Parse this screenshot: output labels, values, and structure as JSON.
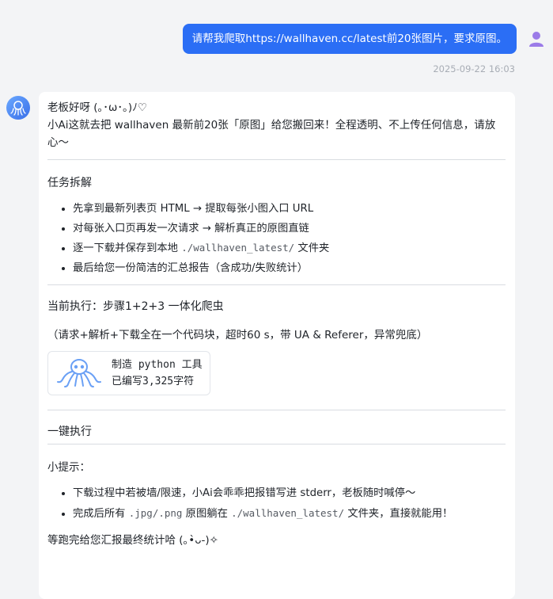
{
  "user_message": {
    "text": "请帮我爬取https://wallhaven.cc/latest前20张图片，要求原图。",
    "timestamp": "2025-09-22 16:03"
  },
  "assistant": {
    "greeting": "老板好呀 (｡･ω･｡)ﾉ♡",
    "intro": "小Ai这就去把 wallhaven 最新前20张「原图」给您搬回来！全程透明、不上传任何信息，请放心～",
    "section_tasks": {
      "title": "任务拆解",
      "items": [
        "先拿到最新列表页 HTML → 提取每张小图入口 URL",
        "对每张入口页再发一次请求 → 解析真正的原图直链",
        {
          "prefix": "逐一下载并保存到本地 ",
          "code": "./wallhaven_latest/",
          "suffix": " 文件夹"
        },
        "最后给您一份简洁的汇总报告（含成功/失败统计）"
      ]
    },
    "current_step": "当前执行：步骤1+2+3 一体化爬虫",
    "step_note": "（请求+解析+下载全在一个代码块，超时60 s，带 UA & Referer，异常兜底）",
    "tool_card": {
      "line1": "制造 python 工具",
      "line2": "已编写3,325字符",
      "icon": "octopus-icon"
    },
    "one_click": "一键执行",
    "tips": {
      "title": "小提示：",
      "item1": "下载过程中若被墙/限速，小Ai会乖乖把报错写进 stderr，老板随时喊停～",
      "item2": {
        "prefix": "完成后所有 ",
        "code1": ".jpg/.png",
        "middle": " 原图躺在 ",
        "code2": "./wallhaven_latest/",
        "suffix": " 文件夹，直接就能用！"
      }
    },
    "closing": "等跑完给您汇报最终统计哈 (｡•̀ᴗ-)✧"
  },
  "colors": {
    "accent": "#2b6ef5",
    "user_avatar": "#9b7be8",
    "octopus": "#6aa0f5"
  }
}
